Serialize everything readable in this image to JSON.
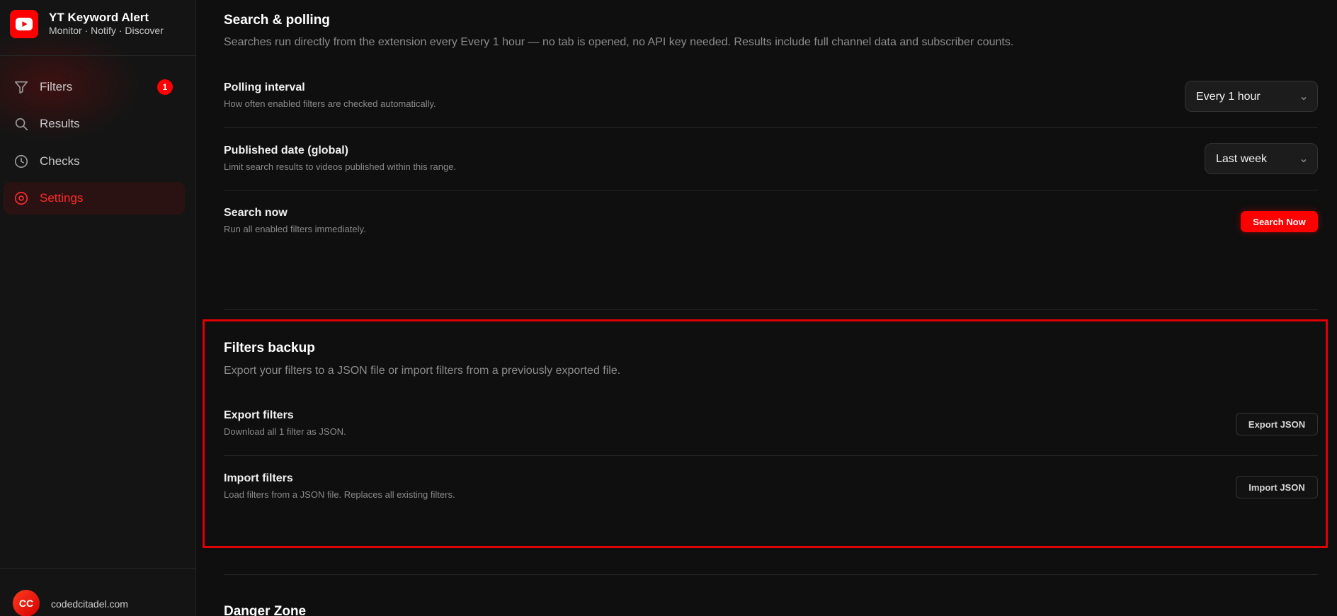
{
  "brand": {
    "title": "YT Keyword Alert",
    "subtitle": "Monitor · Notify · Discover",
    "logo_icon": "youtube-play-icon",
    "accent": "#ff0000"
  },
  "nav": {
    "items": [
      {
        "label": "Filters",
        "icon": "filter-icon",
        "badge": "1",
        "active": false
      },
      {
        "label": "Results",
        "icon": "search-icon",
        "active": false
      },
      {
        "label": "Checks",
        "icon": "clock-icon",
        "active": false
      },
      {
        "label": "Settings",
        "icon": "gear-icon",
        "active": true
      }
    ]
  },
  "user": {
    "initials": "CC",
    "name": "codedcitadel.com"
  },
  "search_polling": {
    "title": "Search & polling",
    "description": "Searches run directly from the extension every Every 1 hour — no tab is opened, no API key needed. Results include full channel data and subscriber counts.",
    "polling_interval": {
      "title": "Polling interval",
      "description": "How often enabled filters are checked automatically.",
      "value": "Every 1 hour"
    },
    "published_date": {
      "title": "Published date (global)",
      "description": "Limit search results to videos published within this range.",
      "value": "Last week"
    },
    "search_now": {
      "title": "Search now",
      "description": "Run all enabled filters immediately.",
      "button": "Search Now"
    }
  },
  "filters_backup": {
    "title": "Filters backup",
    "description": "Export your filters to a JSON file or import filters from a previously exported file.",
    "export": {
      "title": "Export filters",
      "description": "Download all 1 filter as JSON.",
      "button": "Export JSON"
    },
    "import": {
      "title": "Import filters",
      "description": "Load filters from a JSON file. Replaces all existing filters.",
      "button": "Import JSON"
    }
  },
  "danger_zone": {
    "title": "Danger Zone"
  },
  "colors": {
    "background": "#0f0f0f",
    "sidebar": "#141414",
    "accent": "#ff0000",
    "highlight_border": "#e00000"
  }
}
